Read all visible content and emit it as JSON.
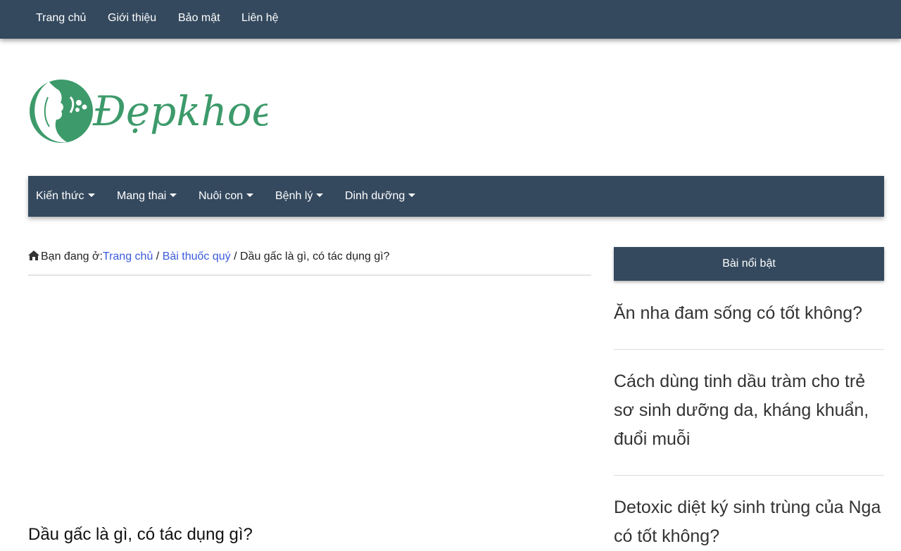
{
  "topnav": {
    "items": [
      "Trang chủ",
      "Giới thiệu",
      "Bảo mật",
      "Liên hệ"
    ]
  },
  "logo": {
    "text": "Đẹpkhoe",
    "color": "#3d9a6a"
  },
  "mainnav": {
    "items": [
      "Kiến thức",
      "Mang thai",
      "Nuôi con",
      "Bệnh lý",
      "Dinh dưỡng"
    ]
  },
  "breadcrumb": {
    "prefix": "Bạn đang ở:",
    "home": "Trang chủ",
    "sep": " / ",
    "category": "Bài thuốc quý",
    "current": "Dầu gấc là gì, có tác dụng gì?"
  },
  "article": {
    "title": "Dầu gấc là gì, có tác dụng gì?"
  },
  "sidebar": {
    "heading": "Bài nổi bật",
    "posts": [
      "Ăn nha đam sống có tốt không?",
      "Cách dùng tinh dầu tràm cho trẻ sơ sinh dưỡng da, kháng khuẩn, đuổi muỗi",
      "Detoxic diệt ký sinh trùng của Nga có tốt không?"
    ]
  },
  "colors": {
    "nav_bg": "#34495e",
    "link": "#3b5bdb",
    "accent": "#3d9a6a"
  }
}
